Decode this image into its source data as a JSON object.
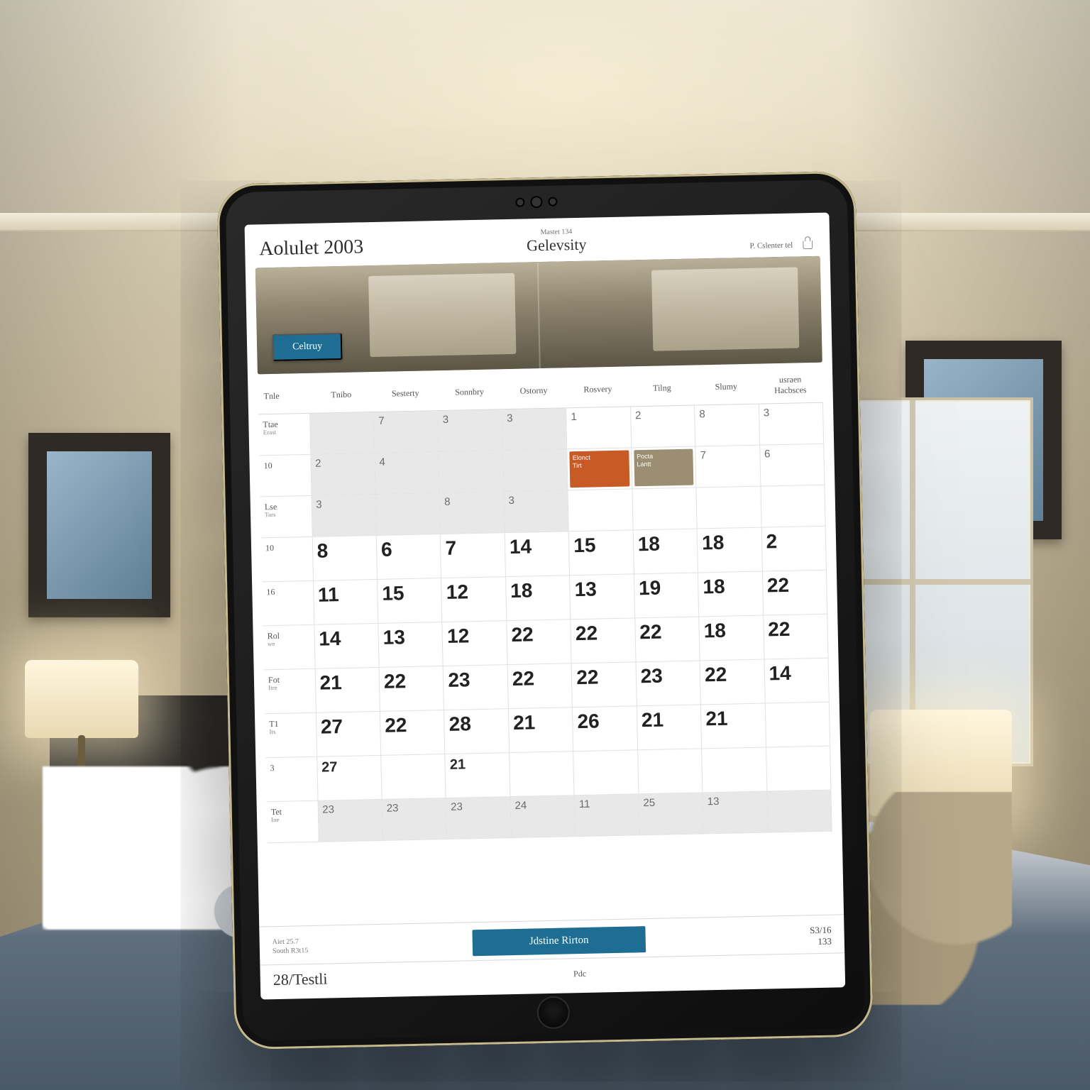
{
  "header": {
    "title_left": "Aolulet 2003",
    "subtitle_top": "Mastet 134",
    "title_center": "Gelevsity",
    "link_right": "P. Cslenter tel",
    "icon_right": "cart-icon"
  },
  "hero": {
    "button_label": "Celtruy"
  },
  "calendar": {
    "day_headers": [
      "Tnle",
      "Tnibo",
      "Sesterty",
      "Sonnbry",
      "Ostorny",
      "Rosvery",
      "Tilng",
      "Slumy",
      "usraen\nHacbsces"
    ],
    "rows": [
      {
        "label": "Ttae",
        "sub": "Erast",
        "style": "sm",
        "cells": [
          "",
          "7",
          "3",
          "3",
          "1",
          "2",
          "8",
          "3"
        ],
        "grey": [
          0,
          1,
          2,
          3
        ],
        "events": {}
      },
      {
        "label": "10",
        "sub": "",
        "style": "sm",
        "cells": [
          "2",
          "4",
          "",
          "",
          "",
          "",
          "7",
          "6"
        ],
        "grey": [
          0,
          1,
          2,
          3
        ],
        "events": {
          "4": {
            "cls": "orange",
            "l1": "Elonct",
            "l2": "Tirt"
          },
          "5": {
            "cls": "taupe",
            "l1": "Pocta",
            "l2": "Lantt"
          }
        }
      },
      {
        "label": "Lse",
        "sub": "Tars",
        "style": "sm",
        "cells": [
          "3",
          "",
          "8",
          "3",
          "",
          "",
          "",
          ""
        ],
        "grey": [
          0,
          1,
          2,
          3
        ],
        "events": {}
      },
      {
        "label": "10",
        "sub": "",
        "style": "lg",
        "cells": [
          "8",
          "6",
          "7",
          "14",
          "15",
          "18",
          "18",
          "2"
        ],
        "grey": [],
        "events": {}
      },
      {
        "label": "16",
        "sub": "",
        "style": "lg",
        "cells": [
          "11",
          "15",
          "12",
          "18",
          "13",
          "19",
          "18",
          "22"
        ],
        "grey": [],
        "events": {}
      },
      {
        "label": "Rol",
        "sub": "we",
        "style": "lg",
        "cells": [
          "14",
          "13",
          "12",
          "22",
          "22",
          "22",
          "18",
          "22"
        ],
        "grey": [],
        "events": {}
      },
      {
        "label": "Fot",
        "sub": "Itre",
        "style": "lg",
        "cells": [
          "21",
          "22",
          "23",
          "22",
          "22",
          "23",
          "22",
          "14"
        ],
        "grey": [],
        "events": {}
      },
      {
        "label": "T1",
        "sub": "Its",
        "style": "lg",
        "cells": [
          "27",
          "22",
          "28",
          "21",
          "26",
          "21",
          "21",
          ""
        ],
        "grey": [],
        "events": {}
      },
      {
        "label": "3",
        "sub": "",
        "style": "md",
        "cells": [
          "27",
          "",
          "21",
          "",
          "",
          "",
          "",
          ""
        ],
        "grey": [],
        "events": {}
      },
      {
        "label": "Tet",
        "sub": "Ine",
        "style": "sm",
        "cells": [
          "23",
          "23",
          "23",
          "24",
          "11",
          "25",
          "13",
          ""
        ],
        "grey": [
          0,
          1,
          2,
          3,
          4,
          5,
          6,
          7
        ],
        "events": {}
      }
    ]
  },
  "footer": {
    "meta_l1": "Aiet  25.7",
    "meta_l2": "Sooth  R3t15",
    "cta_label": "Jdstine Rirton",
    "price_r1": "S3/16",
    "price_r2": "133",
    "bar2_left": "28/Testli",
    "bar2_center": "Pdc",
    "bar2_right": ""
  },
  "colors": {
    "accent": "#1e6e93",
    "event_orange": "#c85a26",
    "event_taupe": "#9b8e73"
  }
}
